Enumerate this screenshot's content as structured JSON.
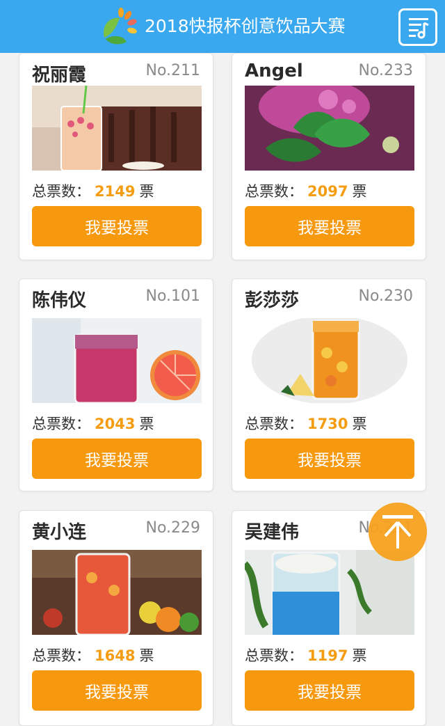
{
  "header": {
    "title": "2018快报杯创意饮品大赛",
    "logo_icon": "leaf-logo-icon",
    "menu_icon": "menu-list-icon",
    "background": "#39a8ee"
  },
  "entries": [
    {
      "name": "祝丽霞",
      "number": "No.211",
      "votes_label": "总票数：",
      "votes": "2149",
      "unit": "票",
      "button": "我要投票"
    },
    {
      "name": "Angel",
      "number": "No.233",
      "votes_label": "总票数：",
      "votes": "2097",
      "unit": "票",
      "button": "我要投票"
    },
    {
      "name": "陈伟仪",
      "number": "No.101",
      "votes_label": "总票数：",
      "votes": "2043",
      "unit": "票",
      "button": "我要投票"
    },
    {
      "name": "彭莎莎",
      "number": "No.230",
      "votes_label": "总票数：",
      "votes": "1730",
      "unit": "票",
      "button": "我要投票"
    },
    {
      "name": "黄小连",
      "number": "No.229",
      "votes_label": "总票数：",
      "votes": "1648",
      "unit": "票",
      "button": "我要投票"
    },
    {
      "name": "吴建伟",
      "number": "No.231",
      "votes_label": "总票数：",
      "votes": "1197",
      "unit": "票",
      "button": "我要投票"
    }
  ],
  "back_to_top_icon": "arrow-up-to-top-icon",
  "colors": {
    "accent": "#f7990f",
    "vote_count": "#f59d12"
  }
}
